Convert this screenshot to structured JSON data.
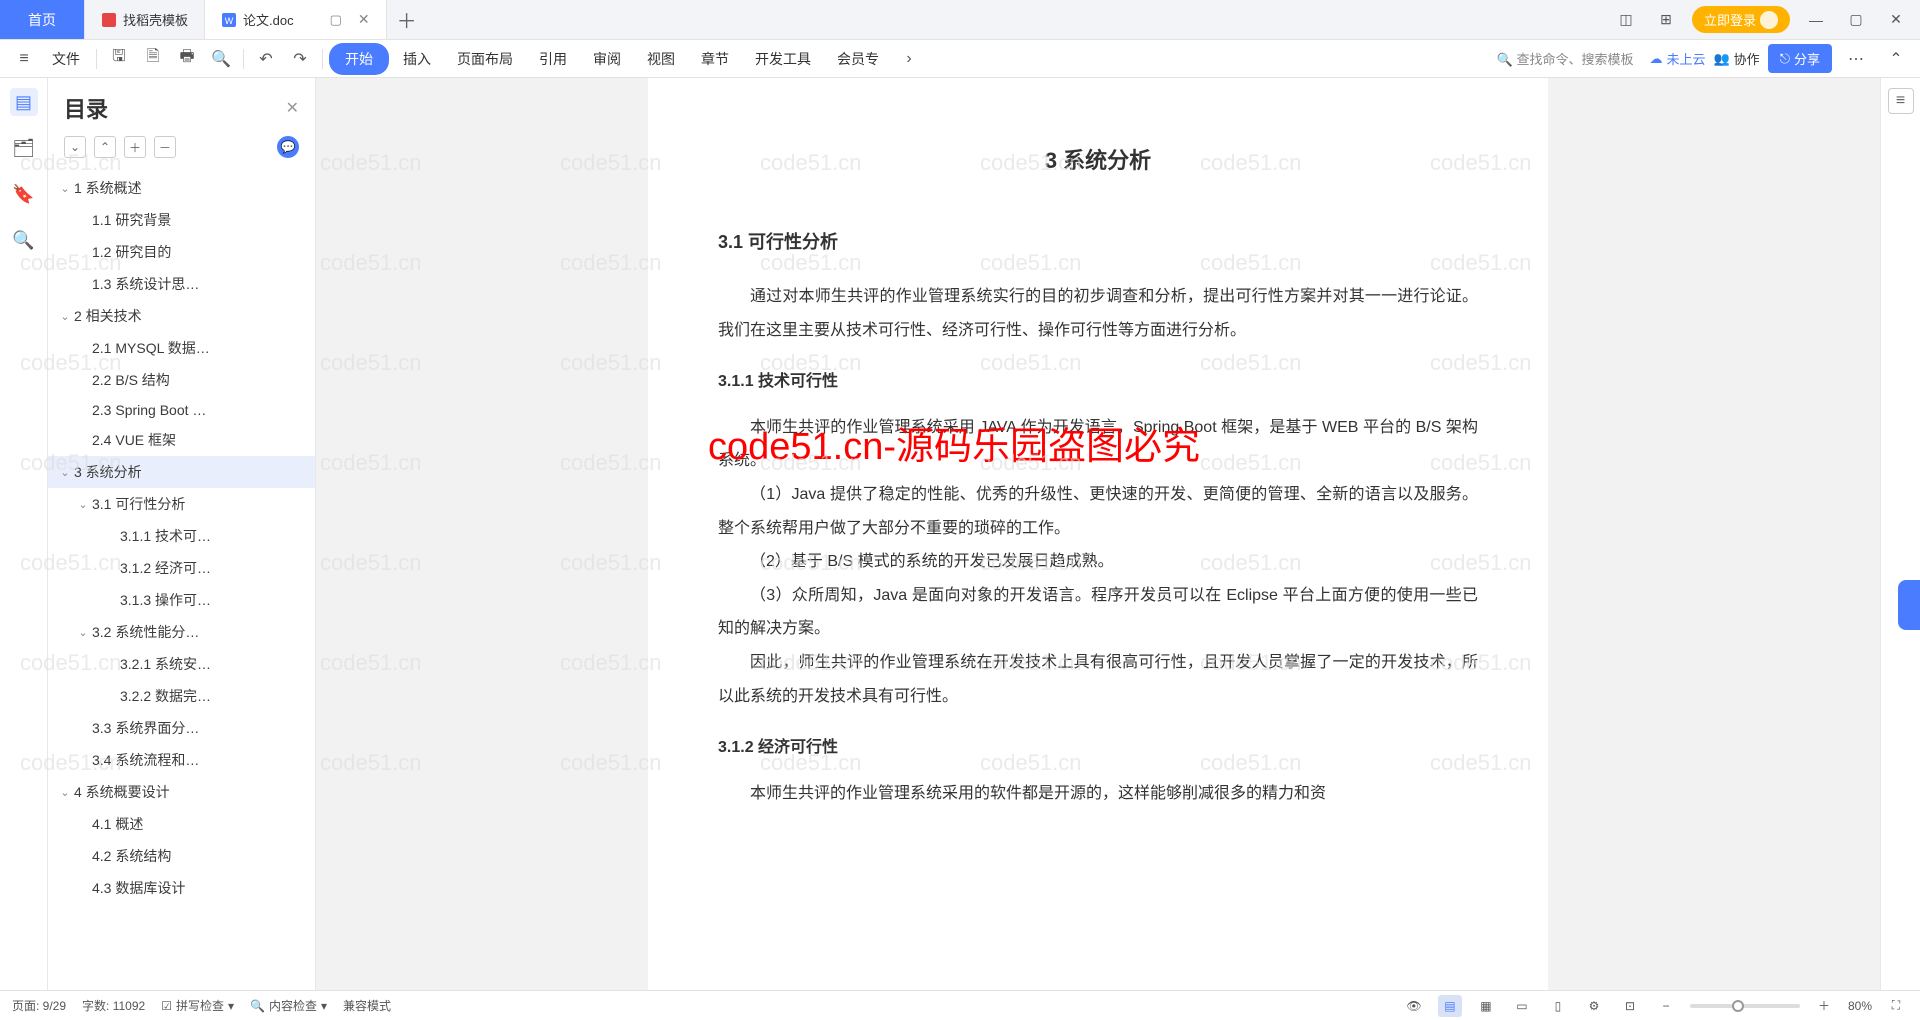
{
  "tabs": {
    "home": "首页",
    "t1": "找稻壳模板",
    "t2": "论文.doc"
  },
  "login_button": "立即登录",
  "ribbon": {
    "file": "文件",
    "items": [
      "开始",
      "插入",
      "页面布局",
      "引用",
      "审阅",
      "视图",
      "章节",
      "开发工具",
      "会员专"
    ],
    "search_placeholder": "查找命令、搜索模板",
    "cloud": "未上云",
    "collab": "协作",
    "share": "分享"
  },
  "outline": {
    "title": "目录",
    "tree": [
      {
        "lvl": 0,
        "caret": true,
        "label": "1 系统概述"
      },
      {
        "lvl": 1,
        "label": "1.1 研究背景"
      },
      {
        "lvl": 1,
        "label": "1.2 研究目的"
      },
      {
        "lvl": 1,
        "label": "1.3 系统设计思…"
      },
      {
        "lvl": 0,
        "caret": true,
        "label": "2 相关技术"
      },
      {
        "lvl": 1,
        "label": "2.1 MYSQL 数据…"
      },
      {
        "lvl": 1,
        "label": "2.2 B/S 结构"
      },
      {
        "lvl": 1,
        "label": "2.3 Spring Boot …"
      },
      {
        "lvl": 1,
        "label": "2.4 VUE 框架"
      },
      {
        "lvl": 0,
        "caret": true,
        "label": "3 系统分析",
        "selected": true
      },
      {
        "lvl": 1,
        "caret": true,
        "label": "3.1 可行性分析"
      },
      {
        "lvl": 2,
        "label": "3.1.1 技术可…"
      },
      {
        "lvl": 2,
        "label": "3.1.2 经济可…"
      },
      {
        "lvl": 2,
        "label": "3.1.3 操作可…"
      },
      {
        "lvl": 1,
        "caret": true,
        "label": "3.2 系统性能分…"
      },
      {
        "lvl": 2,
        "label": "3.2.1 系统安…"
      },
      {
        "lvl": 2,
        "label": "3.2.2 数据完…"
      },
      {
        "lvl": 1,
        "label": "3.3 系统界面分…"
      },
      {
        "lvl": 1,
        "label": "3.4 系统流程和…"
      },
      {
        "lvl": 0,
        "caret": true,
        "label": "4 系统概要设计"
      },
      {
        "lvl": 1,
        "label": "4.1 概述"
      },
      {
        "lvl": 1,
        "label": "4.2 系统结构"
      },
      {
        "lvl": 1,
        "label": "4.3 数据库设计"
      }
    ]
  },
  "document": {
    "h1": "3 系统分析",
    "h2_1": "3.1 可行性分析",
    "p1": "通过对本师生共评的作业管理系统实行的目的初步调查和分析，提出可行性方案并对其一一进行论证。我们在这里主要从技术可行性、经济可行性、操作可行性等方面进行分析。",
    "h3_1": "3.1.1 技术可行性",
    "p2": "本师生共评的作业管理系统采用 JAVA 作为开发语言，Spring Boot 框架，是基于 WEB 平台的 B/S 架构系统。",
    "p3": "（1）Java 提供了稳定的性能、优秀的升级性、更快速的开发、更简便的管理、全新的语言以及服务。整个系统帮用户做了大部分不重要的琐碎的工作。",
    "p4": "（2）基于 B/S 模式的系统的开发已发展日趋成熟。",
    "p5": "（3）众所周知，Java 是面向对象的开发语言。程序开发员可以在 Eclipse 平台上面方便的使用一些已知的解决方案。",
    "p6": "因此，师生共评的作业管理系统在开发技术上具有很高可行性，且开发人员掌握了一定的开发技术，所以此系统的开发技术具有可行性。",
    "h3_2": "3.1.2 经济可行性",
    "p7": "本师生共评的作业管理系统采用的软件都是开源的，这样能够削减很多的精力和资"
  },
  "watermark_red": "code51.cn-源码乐园盗图必究",
  "watermark_grey": "code51.cn",
  "status": {
    "page": "页面: 9/29",
    "words": "字数: 11092",
    "spell": "拼写检查",
    "content": "内容检查",
    "compat": "兼容模式",
    "zoom": "80%"
  }
}
